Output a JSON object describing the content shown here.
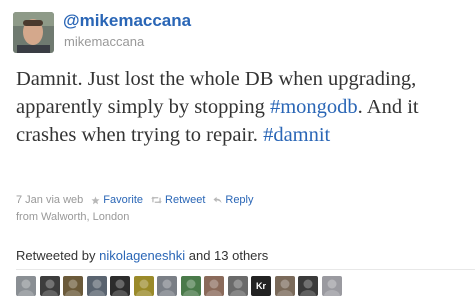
{
  "tweet": {
    "screen_name": "@mikemaccana",
    "username": "mikemaccana",
    "text_parts": {
      "p1": "Damnit. Just lost the whole DB when upgrading, apparently simply by stopping ",
      "hashtag1": "#mongodb",
      "p2": ". And it crashes when trying to repair. ",
      "hashtag2": "#damnit"
    },
    "timestamp": "7 Jan via web",
    "location": "from Walworth, London"
  },
  "actions": {
    "favorite": "Favorite",
    "retweet": "Retweet",
    "reply": "Reply"
  },
  "retweets": {
    "prefix": "Retweeted by ",
    "user": "nikolageneshki",
    "suffix": " and 13 others"
  },
  "retweeter_avatars": [
    {
      "name": "retweeter-avatar-1",
      "color": "#8a8f94"
    },
    {
      "name": "retweeter-avatar-2",
      "color": "#3d3d3d"
    },
    {
      "name": "retweeter-avatar-3",
      "color": "#6b5a3a"
    },
    {
      "name": "retweeter-avatar-4",
      "color": "#5a6470"
    },
    {
      "name": "retweeter-avatar-5",
      "color": "#2c2c2c"
    },
    {
      "name": "retweeter-avatar-6",
      "color": "#9a8a2a"
    },
    {
      "name": "retweeter-avatar-7",
      "color": "#7a7f86"
    },
    {
      "name": "retweeter-avatar-8",
      "color": "#4a7a4a"
    },
    {
      "name": "retweeter-avatar-9",
      "color": "#8a6a5a"
    },
    {
      "name": "retweeter-avatar-10",
      "color": "#6a6a6a"
    },
    {
      "name": "retweeter-avatar-11",
      "color": "#222222",
      "label": "Kr"
    },
    {
      "name": "retweeter-avatar-12",
      "color": "#7a6a5a"
    },
    {
      "name": "retweeter-avatar-13",
      "color": "#3a3a3a"
    },
    {
      "name": "retweeter-avatar-14",
      "color": "#9a9aa0"
    }
  ],
  "colors": {
    "link": "#2a66b6",
    "muted": "#999999",
    "text": "#333333"
  }
}
